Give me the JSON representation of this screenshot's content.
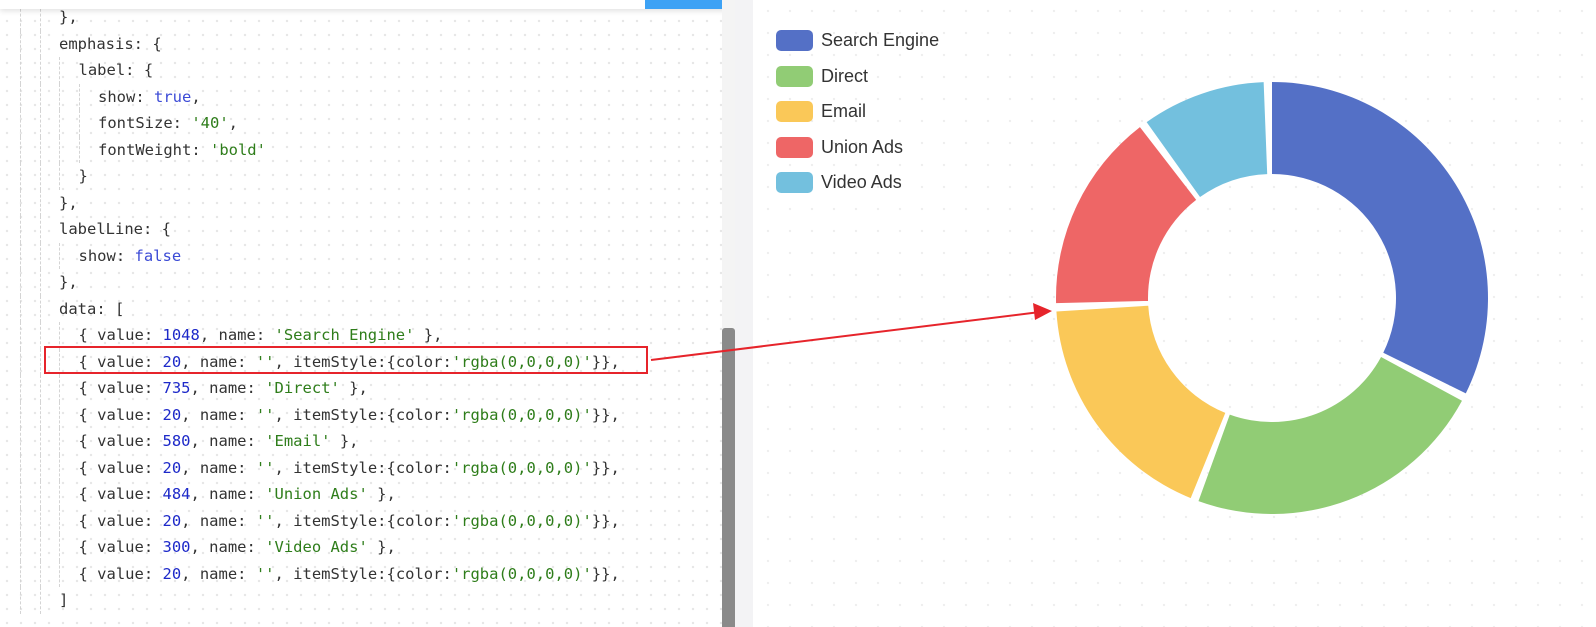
{
  "editor": {
    "lines": [
      {
        "indent": 2,
        "tokens": [
          {
            "t": "},",
            "c": "key"
          }
        ]
      },
      {
        "indent": 2,
        "tokens": [
          {
            "t": "emphasis: {",
            "c": "key"
          }
        ]
      },
      {
        "indent": 3,
        "tokens": [
          {
            "t": "label: {",
            "c": "key"
          }
        ]
      },
      {
        "indent": 4,
        "tokens": [
          {
            "t": "show: ",
            "c": "key"
          },
          {
            "t": "true",
            "c": "bool"
          },
          {
            "t": ",",
            "c": "key"
          }
        ]
      },
      {
        "indent": 4,
        "tokens": [
          {
            "t": "fontSize: ",
            "c": "key"
          },
          {
            "t": "'40'",
            "c": "str"
          },
          {
            "t": ",",
            "c": "key"
          }
        ]
      },
      {
        "indent": 4,
        "tokens": [
          {
            "t": "fontWeight: ",
            "c": "key"
          },
          {
            "t": "'bold'",
            "c": "str"
          }
        ]
      },
      {
        "indent": 3,
        "tokens": [
          {
            "t": "}",
            "c": "key"
          }
        ]
      },
      {
        "indent": 2,
        "tokens": [
          {
            "t": "},",
            "c": "key"
          }
        ]
      },
      {
        "indent": 2,
        "tokens": [
          {
            "t": "labelLine: {",
            "c": "key"
          }
        ]
      },
      {
        "indent": 3,
        "tokens": [
          {
            "t": "show: ",
            "c": "key"
          },
          {
            "t": "false",
            "c": "bool"
          }
        ]
      },
      {
        "indent": 2,
        "tokens": [
          {
            "t": "},",
            "c": "key"
          }
        ]
      },
      {
        "indent": 2,
        "tokens": [
          {
            "t": "data: [",
            "c": "key"
          }
        ]
      },
      {
        "indent": 3,
        "tokens": [
          {
            "t": "{ value: ",
            "c": "key"
          },
          {
            "t": "1048",
            "c": "num"
          },
          {
            "t": ", name: ",
            "c": "key"
          },
          {
            "t": "'Search Engine'",
            "c": "str"
          },
          {
            "t": " },",
            "c": "key"
          }
        ]
      },
      {
        "indent": 3,
        "tokens": [
          {
            "t": "{ value: ",
            "c": "key"
          },
          {
            "t": "20",
            "c": "num"
          },
          {
            "t": ", name: ",
            "c": "key"
          },
          {
            "t": "''",
            "c": "str"
          },
          {
            "t": ", itemStyle:{color:",
            "c": "key"
          },
          {
            "t": "'rgba(0,0,0,0)'",
            "c": "str"
          },
          {
            "t": "}},",
            "c": "key"
          }
        ]
      },
      {
        "indent": 3,
        "tokens": [
          {
            "t": "{ value: ",
            "c": "key"
          },
          {
            "t": "735",
            "c": "num"
          },
          {
            "t": ", name: ",
            "c": "key"
          },
          {
            "t": "'Direct'",
            "c": "str"
          },
          {
            "t": " },",
            "c": "key"
          }
        ]
      },
      {
        "indent": 3,
        "tokens": [
          {
            "t": "{ value: ",
            "c": "key"
          },
          {
            "t": "20",
            "c": "num"
          },
          {
            "t": ", name: ",
            "c": "key"
          },
          {
            "t": "''",
            "c": "str"
          },
          {
            "t": ", itemStyle:{color:",
            "c": "key"
          },
          {
            "t": "'rgba(0,0,0,0)'",
            "c": "str"
          },
          {
            "t": "}},",
            "c": "key"
          }
        ]
      },
      {
        "indent": 3,
        "tokens": [
          {
            "t": "{ value: ",
            "c": "key"
          },
          {
            "t": "580",
            "c": "num"
          },
          {
            "t": ", name: ",
            "c": "key"
          },
          {
            "t": "'Email'",
            "c": "str"
          },
          {
            "t": " },",
            "c": "key"
          }
        ]
      },
      {
        "indent": 3,
        "tokens": [
          {
            "t": "{ value: ",
            "c": "key"
          },
          {
            "t": "20",
            "c": "num"
          },
          {
            "t": ", name: ",
            "c": "key"
          },
          {
            "t": "''",
            "c": "str"
          },
          {
            "t": ", itemStyle:{color:",
            "c": "key"
          },
          {
            "t": "'rgba(0,0,0,0)'",
            "c": "str"
          },
          {
            "t": "}},",
            "c": "key"
          }
        ]
      },
      {
        "indent": 3,
        "tokens": [
          {
            "t": "{ value: ",
            "c": "key"
          },
          {
            "t": "484",
            "c": "num"
          },
          {
            "t": ", name: ",
            "c": "key"
          },
          {
            "t": "'Union Ads'",
            "c": "str"
          },
          {
            "t": " },",
            "c": "key"
          }
        ]
      },
      {
        "indent": 3,
        "tokens": [
          {
            "t": "{ value: ",
            "c": "key"
          },
          {
            "t": "20",
            "c": "num"
          },
          {
            "t": ", name: ",
            "c": "key"
          },
          {
            "t": "''",
            "c": "str"
          },
          {
            "t": ", itemStyle:{color:",
            "c": "key"
          },
          {
            "t": "'rgba(0,0,0,0)'",
            "c": "str"
          },
          {
            "t": "}},",
            "c": "key"
          }
        ]
      },
      {
        "indent": 3,
        "tokens": [
          {
            "t": "{ value: ",
            "c": "key"
          },
          {
            "t": "300",
            "c": "num"
          },
          {
            "t": ", name: ",
            "c": "key"
          },
          {
            "t": "'Video Ads'",
            "c": "str"
          },
          {
            "t": " },",
            "c": "key"
          }
        ]
      },
      {
        "indent": 3,
        "tokens": [
          {
            "t": "{ value: ",
            "c": "key"
          },
          {
            "t": "20",
            "c": "num"
          },
          {
            "t": ", name: ",
            "c": "key"
          },
          {
            "t": "''",
            "c": "str"
          },
          {
            "t": ", itemStyle:{color:",
            "c": "key"
          },
          {
            "t": "'rgba(0,0,0,0)'",
            "c": "str"
          },
          {
            "t": "}},",
            "c": "key"
          }
        ]
      },
      {
        "indent": 2,
        "tokens": [
          {
            "t": "]",
            "c": "key"
          }
        ]
      }
    ],
    "highlighted_line": 13
  },
  "colors": {
    "highlight": "#e6242b",
    "arrow": "#e6242b"
  },
  "chart_data": {
    "type": "pie",
    "variant": "donut",
    "legend": "top-left",
    "slices": [
      {
        "name": "Search Engine",
        "value": 1048,
        "color": "#5470c6"
      },
      {
        "name": "",
        "value": 20,
        "color": "rgba(0,0,0,0)"
      },
      {
        "name": "Direct",
        "value": 735,
        "color": "#91cc75"
      },
      {
        "name": "",
        "value": 20,
        "color": "rgba(0,0,0,0)"
      },
      {
        "name": "Email",
        "value": 580,
        "color": "#fac858"
      },
      {
        "name": "",
        "value": 20,
        "color": "rgba(0,0,0,0)"
      },
      {
        "name": "Union Ads",
        "value": 484,
        "color": "#ee6666"
      },
      {
        "name": "",
        "value": 20,
        "color": "rgba(0,0,0,0)"
      },
      {
        "name": "Video Ads",
        "value": 300,
        "color": "#73c0de"
      },
      {
        "name": "",
        "value": 20,
        "color": "rgba(0,0,0,0)"
      }
    ]
  }
}
